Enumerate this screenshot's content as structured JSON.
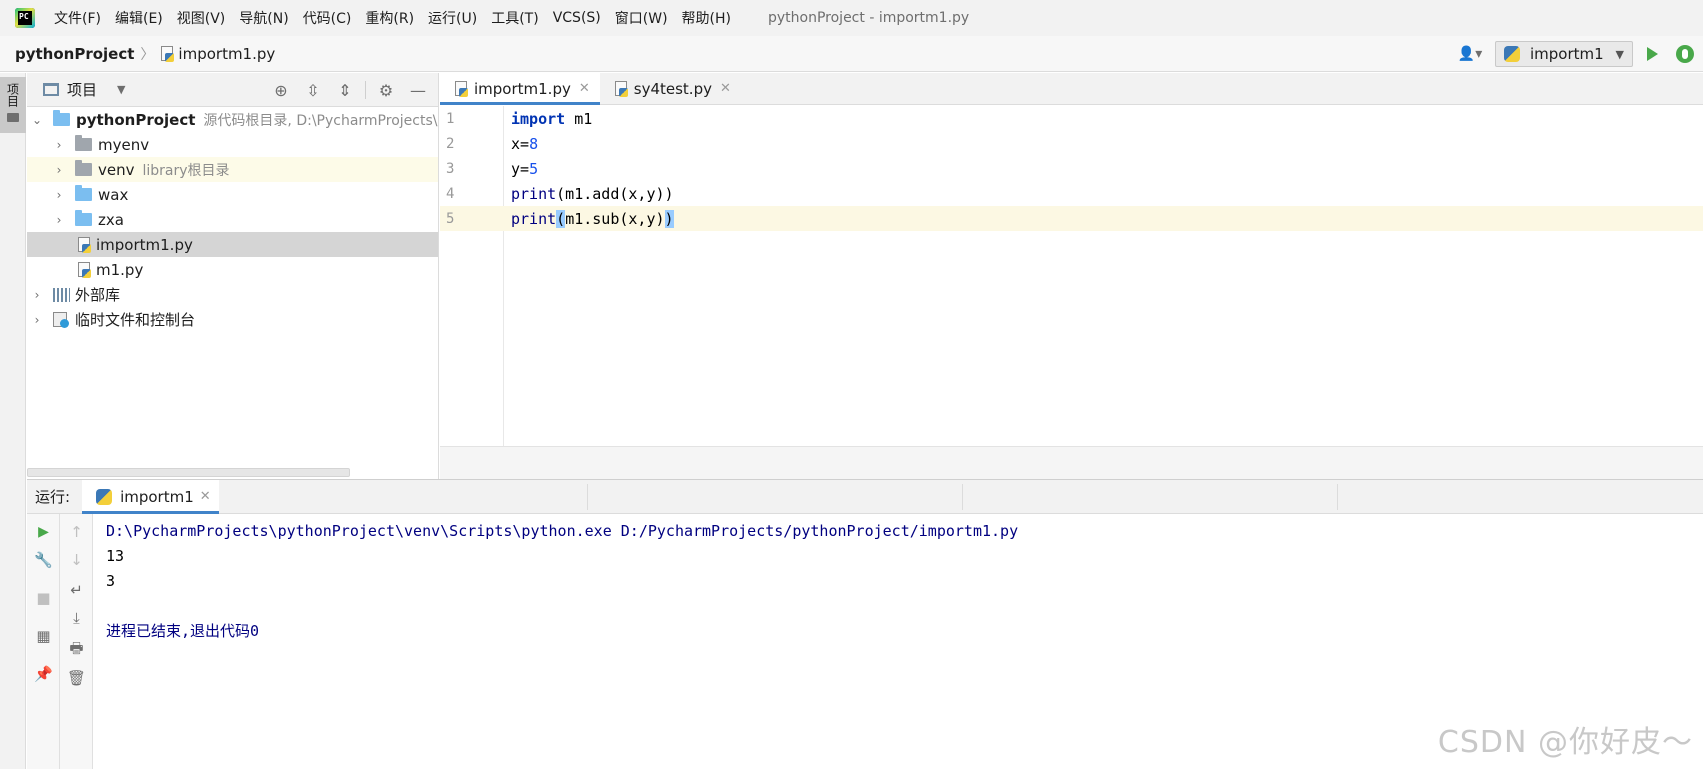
{
  "menubar": {
    "items": [
      "文件(F)",
      "编辑(E)",
      "视图(V)",
      "导航(N)",
      "代码(C)",
      "重构(R)",
      "运行(U)",
      "工具(T)",
      "VCS(S)",
      "窗口(W)",
      "帮助(H)"
    ],
    "window_title": "pythonProject - importm1.py"
  },
  "navbar": {
    "project": "pythonProject",
    "file": "importm1.py",
    "run_config": "importm1"
  },
  "left_stripe": {
    "project_tab": "项目"
  },
  "project_panel": {
    "title": "项目",
    "tree": [
      {
        "label": "pythonProject",
        "hint": "源代码根目录, D:\\PycharmProjects\\"
      },
      {
        "label": "myenv",
        "hint": ""
      },
      {
        "label": "venv",
        "hint": "library根目录"
      },
      {
        "label": "wax",
        "hint": ""
      },
      {
        "label": "zxa",
        "hint": ""
      },
      {
        "label": "importm1.py",
        "hint": ""
      },
      {
        "label": "m1.py",
        "hint": ""
      },
      {
        "label": "外部库",
        "hint": ""
      },
      {
        "label": "临时文件和控制台",
        "hint": ""
      }
    ]
  },
  "editor": {
    "tabs": [
      {
        "label": "importm1.py",
        "active": true
      },
      {
        "label": "sy4test.py",
        "active": false
      }
    ],
    "lines": [
      {
        "num": "1",
        "text": "import m1"
      },
      {
        "num": "2",
        "text": "x=8"
      },
      {
        "num": "3",
        "text": "y=5"
      },
      {
        "num": "4",
        "text": "print(m1.add(x,y))"
      },
      {
        "num": "5",
        "text": "print(m1.sub(x,y))"
      }
    ]
  },
  "run_panel": {
    "label": "运行:",
    "tab": "importm1",
    "output": [
      "D:\\PycharmProjects\\pythonProject\\venv\\Scripts\\python.exe D:/PycharmProjects/pythonProject/importm1.py",
      "13",
      "3",
      "",
      "进程已结束,退出代码0"
    ]
  },
  "watermark": "CSDN @你好皮～"
}
